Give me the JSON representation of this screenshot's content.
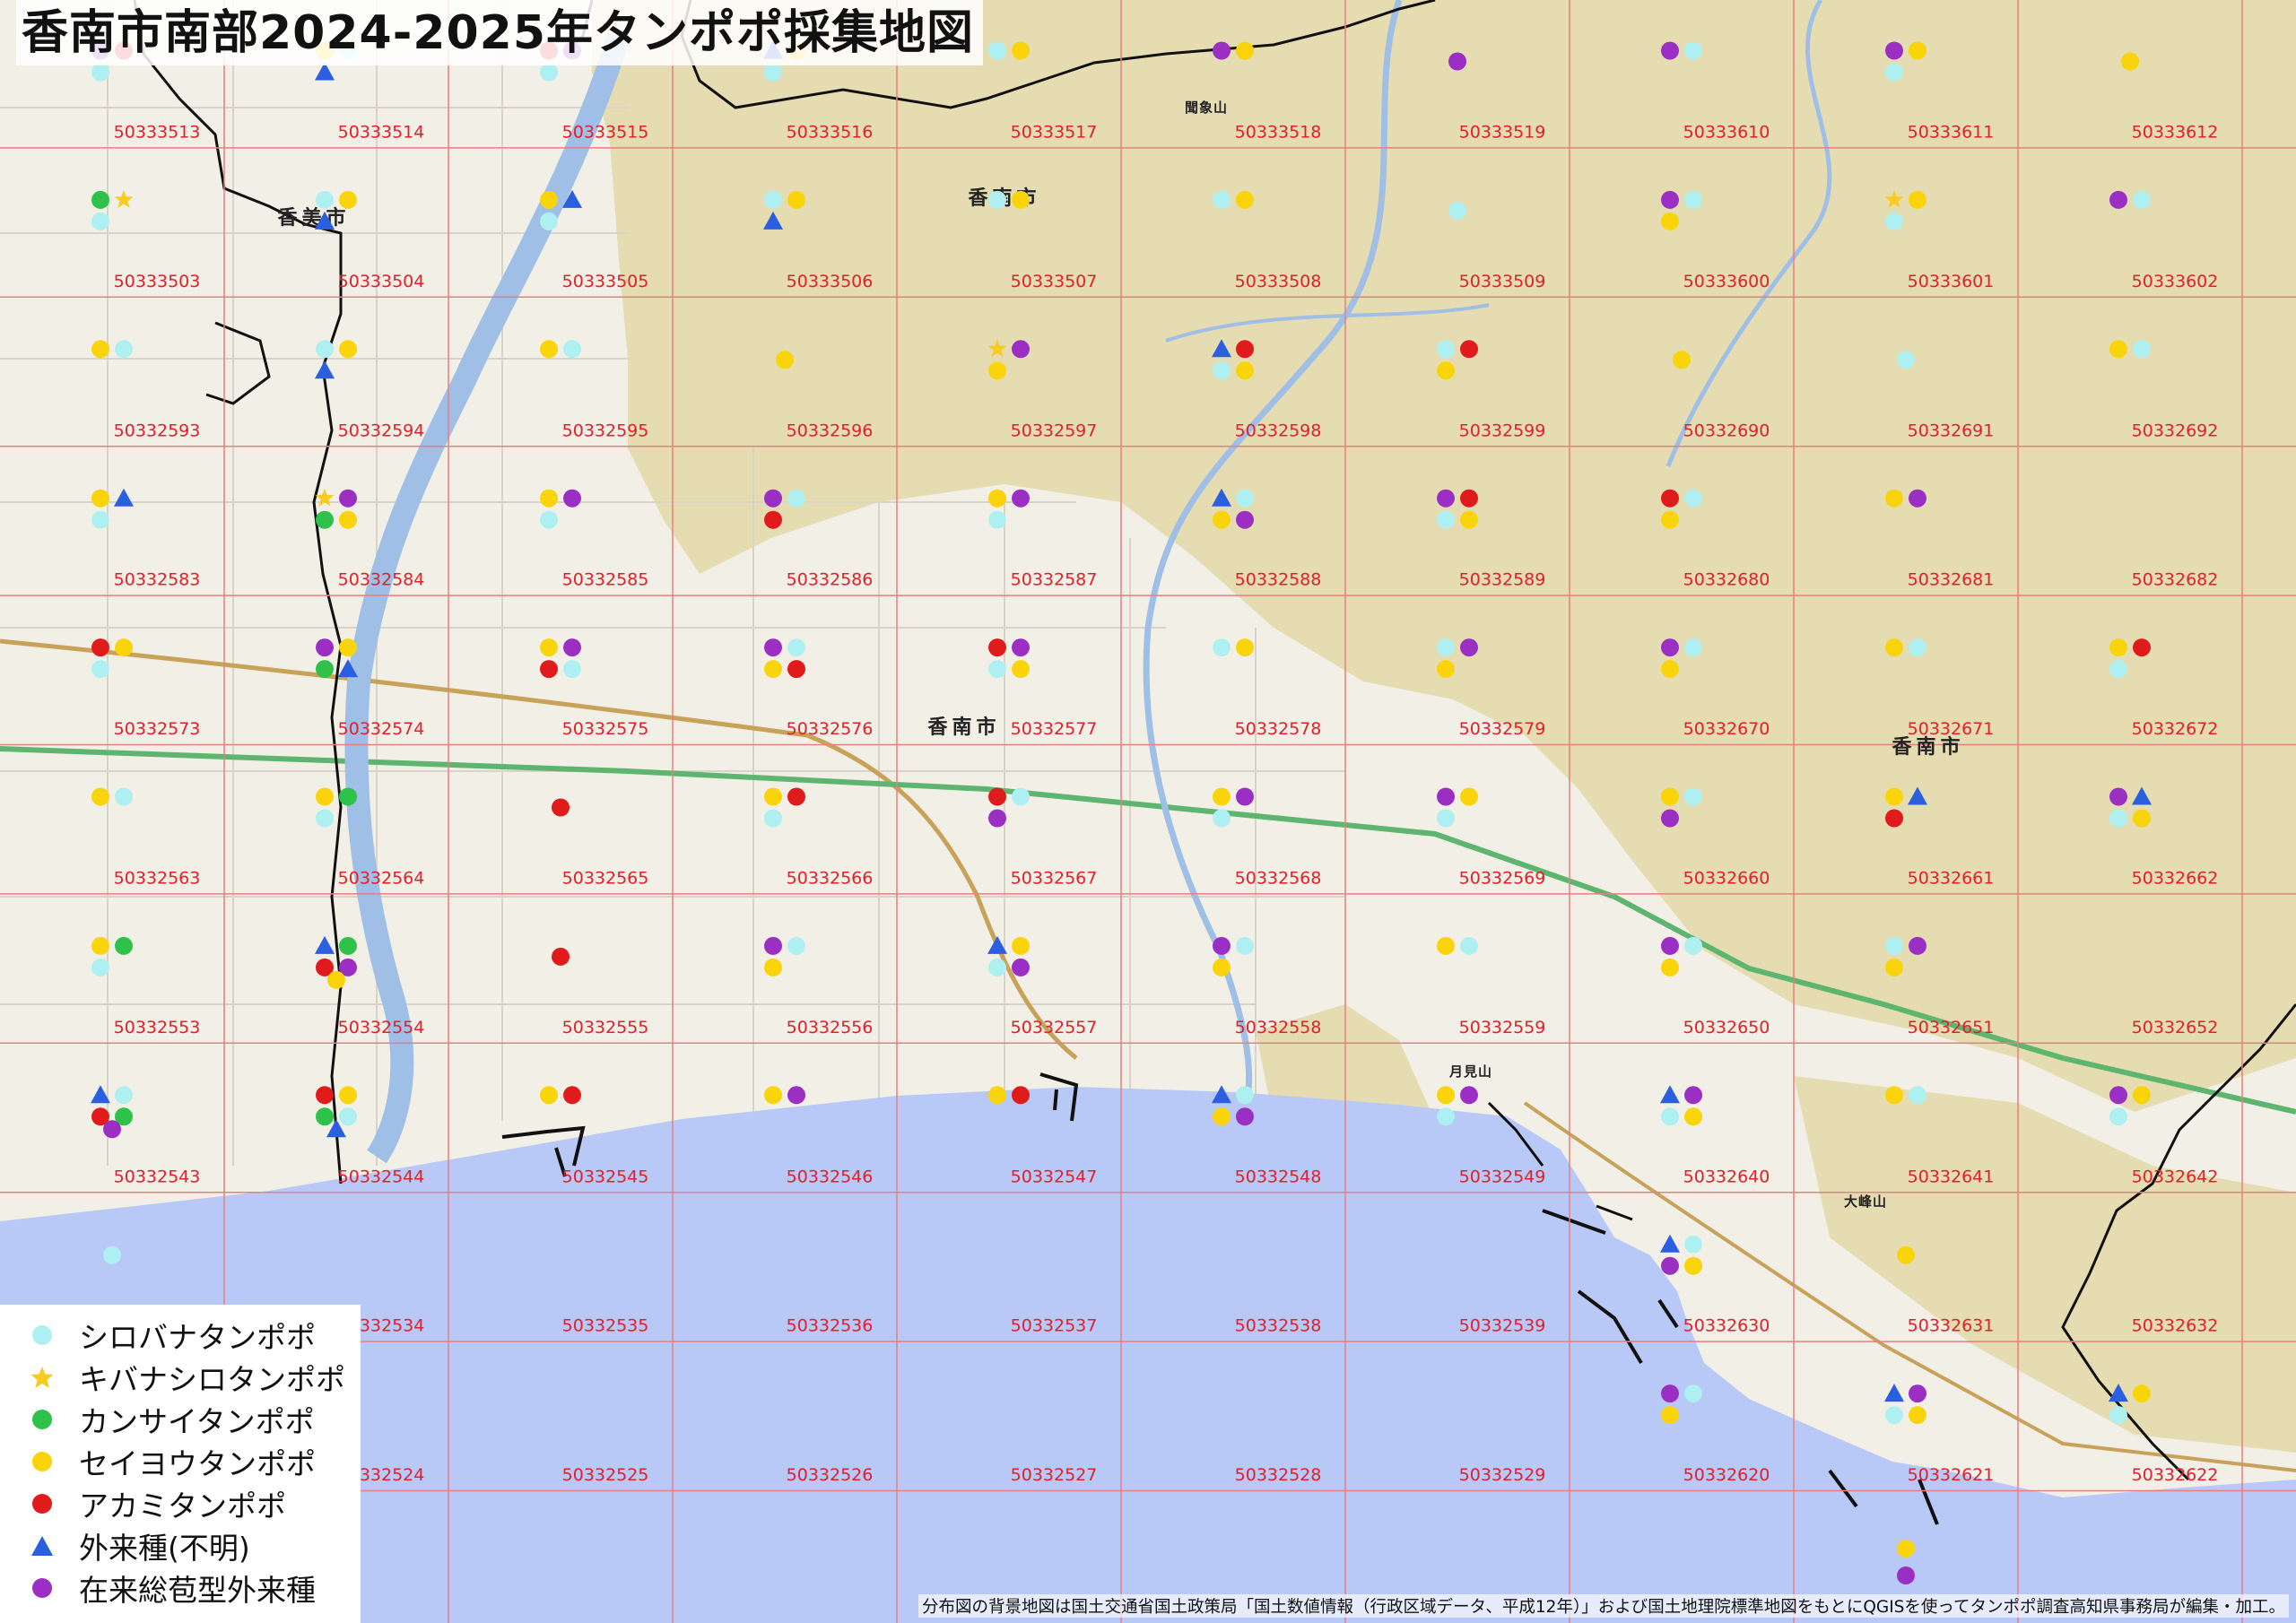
{
  "title": "香南市南部2024-2025年タンポポ採集地図",
  "footer": "分布図の背景地図は国土交通省国土政策局「国土数値情報（行政区域データ、平成12年）」および国土地理院標準地図をもとにQGISを使ってタンポポ調査高知県事務局が編集・加工。",
  "colors": {
    "sea": "#b9c9f7",
    "land": "#f2f0e6",
    "hills": "#e6dcb2",
    "grid": "#e58080",
    "grid_label": "#e0202a",
    "river": "#9fbfe6",
    "boundary": "#111111",
    "road": "#c9a25a",
    "rail": "#5db56f"
  },
  "place_names": [
    "香南市",
    "香南市",
    "香南市",
    "香美市",
    "大峰山",
    "月見山",
    "聞象山"
  ],
  "grid": {
    "rows": [
      [
        "50333513",
        "50333514",
        "50333515",
        "50333516",
        "50333517",
        "50333518",
        "50333519",
        "50333610",
        "50333611",
        "50333612"
      ],
      [
        "50333503",
        "50333504",
        "50333505",
        "50333506",
        "50333507",
        "50333508",
        "50333509",
        "50333600",
        "50333601",
        "50333602"
      ],
      [
        "50332593",
        "50332594",
        "50332595",
        "50332596",
        "50332597",
        "50332598",
        "50332599",
        "50332690",
        "50332691",
        "50332692"
      ],
      [
        "50332583",
        "50332584",
        "50332585",
        "50332586",
        "50332587",
        "50332588",
        "50332589",
        "50332680",
        "50332681",
        "50332682"
      ],
      [
        "50332573",
        "50332574",
        "50332575",
        "50332576",
        "50332577",
        "50332578",
        "50332579",
        "50332670",
        "50332671",
        "50332672"
      ],
      [
        "50332563",
        "50332564",
        "50332565",
        "50332566",
        "50332567",
        "50332568",
        "50332569",
        "50332660",
        "50332661",
        "50332662"
      ],
      [
        "50332553",
        "50332554",
        "50332555",
        "50332556",
        "50332557",
        "50332558",
        "50332559",
        "50332650",
        "50332651",
        "50332652"
      ],
      [
        "50332543",
        "50332544",
        "50332545",
        "50332546",
        "50332547",
        "50332548",
        "50332549",
        "50332640",
        "50332641",
        "50332642"
      ],
      [
        "50332533",
        "50332534",
        "50332535",
        "50332536",
        "50332537",
        "50332538",
        "50332539",
        "50332630",
        "50332631",
        "50332632"
      ],
      [
        "50332523",
        "50332524",
        "50332525",
        "50332526",
        "50332527",
        "50332528",
        "50332529",
        "50332620",
        "50332621",
        "50332622"
      ]
    ]
  },
  "legend": [
    {
      "key": "W",
      "label": "シロバナタンポポ",
      "shape": "circle",
      "color": "#aef0f2"
    },
    {
      "key": "K",
      "label": "キバナシロタンポポ",
      "shape": "star",
      "color": "#f7cb22"
    },
    {
      "key": "G",
      "label": "カンサイタンポポ",
      "shape": "circle",
      "color": "#2ec24a"
    },
    {
      "key": "Y",
      "label": "セイヨウタンポポ",
      "shape": "circle",
      "color": "#fad40a"
    },
    {
      "key": "R",
      "label": "アカミタンポポ",
      "shape": "circle",
      "color": "#e01b1b"
    },
    {
      "key": "B",
      "label": "外来種(不明)",
      "shape": "triangle",
      "color": "#2a5fe0"
    },
    {
      "key": "P",
      "label": "在来総苞型外来種",
      "shape": "circle",
      "color": "#9b2fc4"
    }
  ],
  "observations": {
    "50333513": "PRW",
    "50333514": "YWB",
    "50333515": "RPW",
    "50333516": "BYW",
    "50333517": "WY",
    "50333518": "PY",
    "50333519": "P",
    "50333610": "PW",
    "50333611": "PYW",
    "50333612": "Y",
    "50333503": "GKW",
    "50333504": "WYB",
    "50333505": "YBW",
    "50333506": "WYB",
    "50333507": "WY",
    "50333508": "WY",
    "50333509": "W",
    "50333600": "PWY",
    "50333601": "KYW",
    "50333602": "PW",
    "50332593": "YW",
    "50332594": "WYB",
    "50332595": "YW",
    "50332596": "Y",
    "50332597": "KPY",
    "50332598": "BRWY",
    "50332599": "WRY",
    "50332690": "Y",
    "50332691": "W",
    "50332692": "YW",
    "50332583": "YBW",
    "50332584": "KPGY",
    "50332585": "YPW",
    "50332586": "PWR",
    "50332587": "YPW",
    "50332588": "BWYP",
    "50332589": "PRWY",
    "50332680": "RWY",
    "50332681": "YP",
    "50332682": "",
    "50332573": "RYW",
    "50332574": "PYGB",
    "50332575": "YPRW",
    "50332576": "PWYR",
    "50332577": "RPWY",
    "50332578": "WY",
    "50332579": "WPY",
    "50332670": "PWY",
    "50332671": "YW",
    "50332672": "YRW",
    "50332563": "YW",
    "50332564": "YGW",
    "50332565": "R",
    "50332566": "YRW",
    "50332567": "RWP",
    "50332568": "YPW",
    "50332569": "PYW",
    "50332660": "YWP",
    "50332661": "YBR",
    "50332662": "PBWY",
    "50332553": "YGW",
    "50332554": "BGRPY",
    "50332555": "R",
    "50332556": "PWY",
    "50332557": "BYWP",
    "50332558": "PWY",
    "50332559": "YW",
    "50332650": "PWY",
    "50332651": "WPY",
    "50332652": "",
    "50332543": "BWRGP",
    "50332544": "RYGWB",
    "50332545": "YR",
    "50332546": "YP",
    "50332547": "YR",
    "50332548": "BWYP",
    "50332549": "YPW",
    "50332640": "BPWY",
    "50332641": "YW",
    "50332642": "PYW",
    "50332533": "W",
    "50332534": "",
    "50332535": "",
    "50332536": "",
    "50332537": "",
    "50332538": "",
    "50332539": "",
    "50332630": "BWPY",
    "50332631": "Y",
    "50332632": "",
    "50332523": "",
    "50332524": "",
    "50332525": "",
    "50332526": "",
    "50332527": "",
    "50332528": "",
    "50332529": "",
    "50332620": "PWY",
    "50332621": "BPWY",
    "50332622": "BYW"
  },
  "extra_observations": "YP"
}
